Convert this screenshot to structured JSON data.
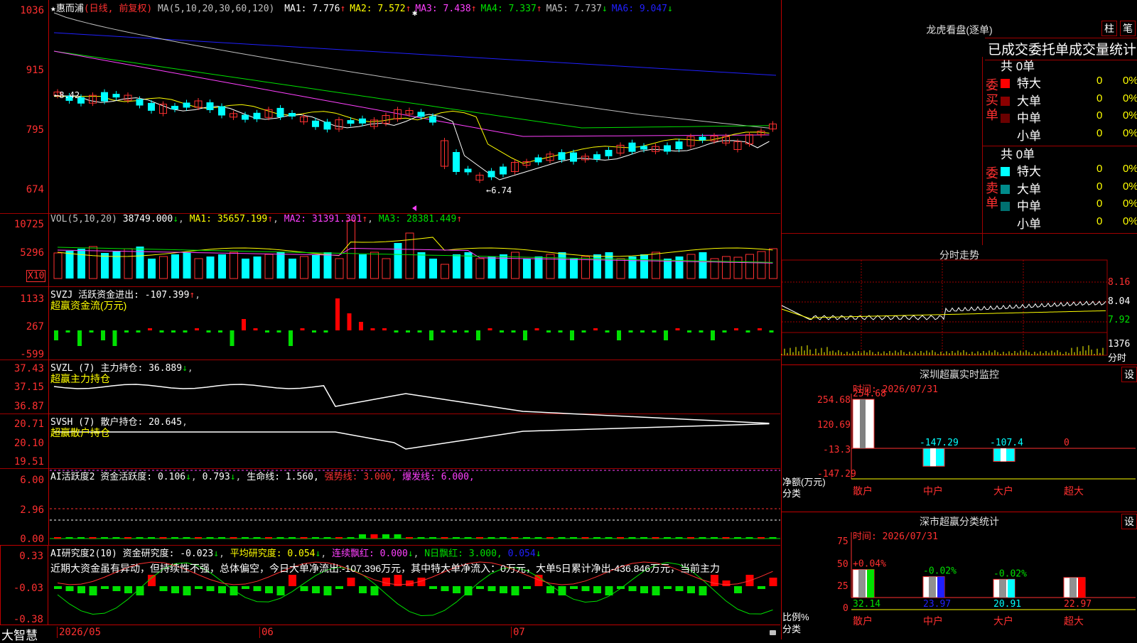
{
  "stock": {
    "star": "★",
    "name": "惠而浦",
    "period": "(日线, 前复权)"
  },
  "ma_line": {
    "label": "MA(5,10,20,30,60,120)",
    "items": [
      {
        "text": "MA1: 7.776",
        "arrow": "↑",
        "color": "#ffffff"
      },
      {
        "text": "MA2: 7.572",
        "arrow": "↑",
        "color": "#ffff00"
      },
      {
        "text": "MA3: 7.438",
        "arrow": "↑",
        "color": "#ff40ff"
      },
      {
        "text": "MA4: 7.337",
        "arrow": "↑",
        "color": "#00e000"
      },
      {
        "text": "MA5: 7.737",
        "arrow": "↓",
        "color": "#c0c0c0"
      },
      {
        "text": "MA6: 9.047",
        "arrow": "↓",
        "color": "#2020ff"
      }
    ]
  },
  "price_axis": [
    "1036",
    "915",
    "795",
    "674"
  ],
  "annotations": {
    "high": "←8.42",
    "low": "←6.74",
    "star_mark": "✱"
  },
  "vol": {
    "label": "VOL(5,10,20)",
    "value": "38749.000",
    "arrow": "↓",
    "ma1": "MA1: 35657.199",
    "ma2": "MA2: 31391.301",
    "ma3": "MA3: 28381.449",
    "axis": [
      "10725",
      "5296"
    ],
    "unit": "X10"
  },
  "svzj": {
    "label": "SVZJ  活跃资金进出: -107.399",
    "arrow": "↑",
    "sub": "超赢资金流(万元)",
    "axis": [
      "1133",
      "267",
      "-599"
    ]
  },
  "svzl": {
    "label": "SVZL (7) 主力持仓: 36.889",
    "arrow": "↓",
    "sub": "超赢主力持仓",
    "axis": [
      "37.43",
      "37.15",
      "36.87"
    ]
  },
  "svsh": {
    "label": "SVSH (7) 散户持仓: 20.645",
    "sub": "超赢散户持仓",
    "axis": [
      "20.71",
      "20.10",
      "19.51"
    ]
  },
  "ai_active": {
    "label": "AI活跃度2 资金活跃度: 0.106",
    "arrow": "↓",
    "v2": "0.793",
    "life": "生命线: 1.560,",
    "strong": "强势线: 3.000,",
    "burst": "爆发线: 6.000,",
    "axis": [
      "6.00",
      "2.96",
      "0.00"
    ]
  },
  "ai_research": {
    "label": "AI研究度2(10) 资金研究度: -0.023",
    "arrow": "↓",
    "avg": "平均研究度: 0.054",
    "lianxu": "连续飘红: 0.000",
    "nday": "N日飘红: 3.000,",
    "v5": "0.054",
    "axis": [
      "0.33",
      "-0.03",
      "-0.38"
    ],
    "comment": "近期大资金虽有异动，但持续性不强，总体偏空，今日大单净流出:-107.396万元，其中特大单净流入：0万元，大单5日累计净出-436.846万元，当前主力"
  },
  "bottom": {
    "brand": "大智慧",
    "dates": [
      "2026/05",
      "06",
      "07"
    ]
  },
  "side": {
    "longhu": {
      "title": "龙虎看盘(逐单)",
      "btn1": "柱",
      "btn2": "笔",
      "subtitle": "已成交委托单成交量统计",
      "buy": {
        "label": "委买单",
        "total": "共 0单",
        "rows": [
          {
            "name": "特大",
            "val": "0",
            "pct": "0%",
            "color": "#ff0000"
          },
          {
            "name": "大单",
            "val": "0",
            "pct": "0%",
            "color": "#8b0000"
          },
          {
            "name": "中单",
            "val": "0",
            "pct": "0%",
            "color": "#6a0000"
          },
          {
            "name": "小单",
            "val": "0",
            "pct": "0%",
            "color": ""
          }
        ]
      },
      "sell": {
        "label": "委卖单",
        "total": "共 0单",
        "rows": [
          {
            "name": "特大",
            "val": "0",
            "pct": "0%",
            "color": "#00ffff"
          },
          {
            "name": "大单",
            "val": "0",
            "pct": "0%",
            "color": "#008b8b"
          },
          {
            "name": "中单",
            "val": "0",
            "pct": "0%",
            "color": "#007070"
          },
          {
            "name": "小单",
            "val": "0",
            "pct": "0%",
            "color": ""
          }
        ]
      }
    },
    "fenshi": {
      "title": "分时走势",
      "axis": [
        "8.16",
        "8.04",
        "7.92"
      ],
      "vol": "1376",
      "unit": "分时"
    },
    "monitor": {
      "title": "深圳超赢实时监控",
      "btn": "设",
      "time": "时间: 2026/07/31",
      "axis": [
        "254.68",
        "120.69",
        "-13.3",
        "-147.29"
      ],
      "bars": [
        {
          "cat": "散户",
          "val": "254.68",
          "color": "#ffffff"
        },
        {
          "cat": "中户",
          "val": "-147.29",
          "color": "#00ffff"
        },
        {
          "cat": "大户",
          "val": "-107.4",
          "color": "#00ffff"
        },
        {
          "cat": "超大",
          "val": "0",
          "color": "#ffffff"
        }
      ],
      "ylabel": "净额(万元)",
      "xlabel": "分类"
    },
    "classify": {
      "title": "深市超赢分类统计",
      "btn": "设",
      "time": "时间: 2026/07/31",
      "axis": [
        "75",
        "50",
        "25",
        "0"
      ],
      "bars": [
        {
          "cat": "散户",
          "pct": "32.14",
          "delta": "+0.04%",
          "dcolor": "#ff3030",
          "color": "#ffffff",
          "accent": "#00e000"
        },
        {
          "cat": "中户",
          "pct": "23.97",
          "delta": "-0.02%",
          "dcolor": "#00e000",
          "color": "#ffffff",
          "accent": "#2020ff"
        },
        {
          "cat": "大户",
          "pct": "20.91",
          "delta": "-0.02%",
          "dcolor": "#00e000",
          "color": "#ffffff",
          "accent": "#00ffff"
        },
        {
          "cat": "超大",
          "pct": "22.97",
          "delta": "",
          "dcolor": "#ff3030",
          "color": "#ffffff",
          "accent": "#ff0000"
        }
      ],
      "ylabel": "比例%",
      "xlabel": "分类"
    }
  }
}
